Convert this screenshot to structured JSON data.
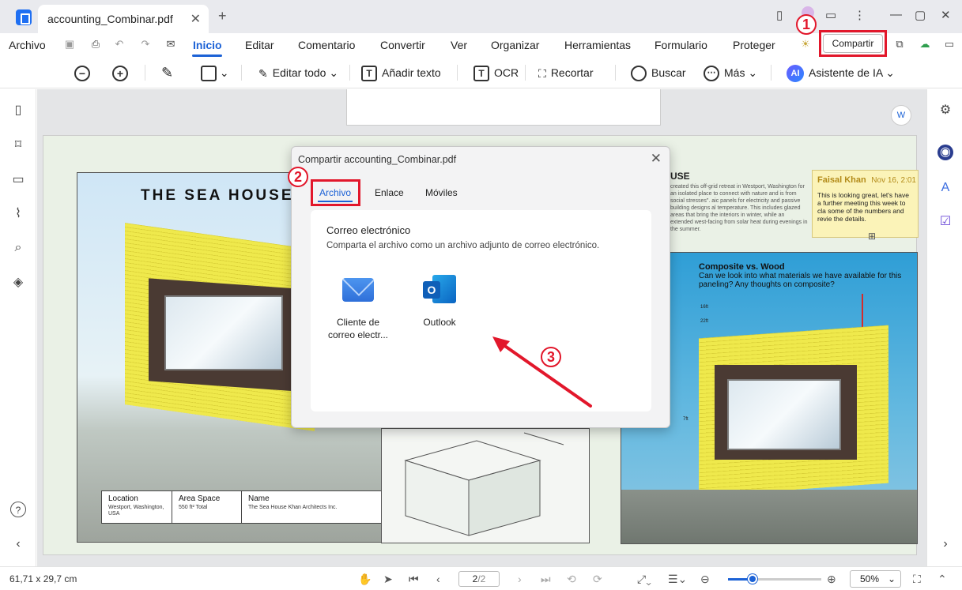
{
  "window": {
    "tab_title": "accounting_Combinar.pdf",
    "tab_close": "✕",
    "tab_add": "+"
  },
  "menu": {
    "items": [
      "Archivo",
      "Inicio",
      "Editar",
      "Comentario",
      "Convertir",
      "Ver",
      "Organizar",
      "Herramientas",
      "Formulario",
      "Proteger"
    ],
    "active": "Inicio",
    "share_label": "Compartir"
  },
  "toolbar": {
    "edit_all": "Editar todo",
    "add_text": "Añadir texto",
    "ocr": "OCR",
    "crop": "Recortar",
    "search": "Buscar",
    "more": "Más",
    "ai_assistant": "Asistente de IA",
    "ai_badge": "AI"
  },
  "document": {
    "sea_house_title": "THE SEA HOUSE",
    "right_heading": "USE",
    "right_text": "created this off-grid retreat in Westport, Washington for an isolated place to connect with nature and is from social stresses\". aic panels for electricity and passive building designs al temperature. This includes glazed areas that bring the interiors in winter, while an extended west-facing from solar heat during evenings in the summer.",
    "note": {
      "author": "Faisal Khan",
      "date": "Nov 16, 2:01",
      "text": "This is looking great, let's have a further meeting this week to cla some of the numbers and revie the details."
    },
    "composite_title": "Composite vs. Wood",
    "composite_question": "Can we look into what materials we have available for this paneling? Any thoughts on composite?",
    "dimensions": [
      "16ft",
      "22ft",
      "7ft"
    ],
    "info_table": [
      {
        "header": "Location",
        "value": "Westport, Washington, USA"
      },
      {
        "header": "Area Space",
        "value": "550 ft² Total"
      },
      {
        "header": "Name",
        "value": "The Sea House Khan Architects Inc."
      }
    ]
  },
  "dialog": {
    "title": "Compartir accounting_Combinar.pdf",
    "close": "✕",
    "tabs": [
      "Archivo",
      "Enlace",
      "Móviles"
    ],
    "active_tab": "Archivo",
    "section_title": "Correo electrónico",
    "section_desc": "Comparta el archivo como un archivo adjunto de correo electrónico.",
    "options": [
      {
        "label": "Cliente de correo electr...",
        "icon": "mail-icon"
      },
      {
        "label": "Outlook",
        "icon": "outlook-icon",
        "badge": "O"
      }
    ]
  },
  "annotations": {
    "step1": "1",
    "step2": "2",
    "step3": "3",
    "color": "#e2172b"
  },
  "status": {
    "page_size": "61,71 x 29,7 cm",
    "page_current": "2",
    "page_total": "/2",
    "zoom": "50%",
    "zoom_fraction": 0.26
  },
  "colors": {
    "accent": "#1c62d6",
    "annotation_red": "#e2172b"
  }
}
